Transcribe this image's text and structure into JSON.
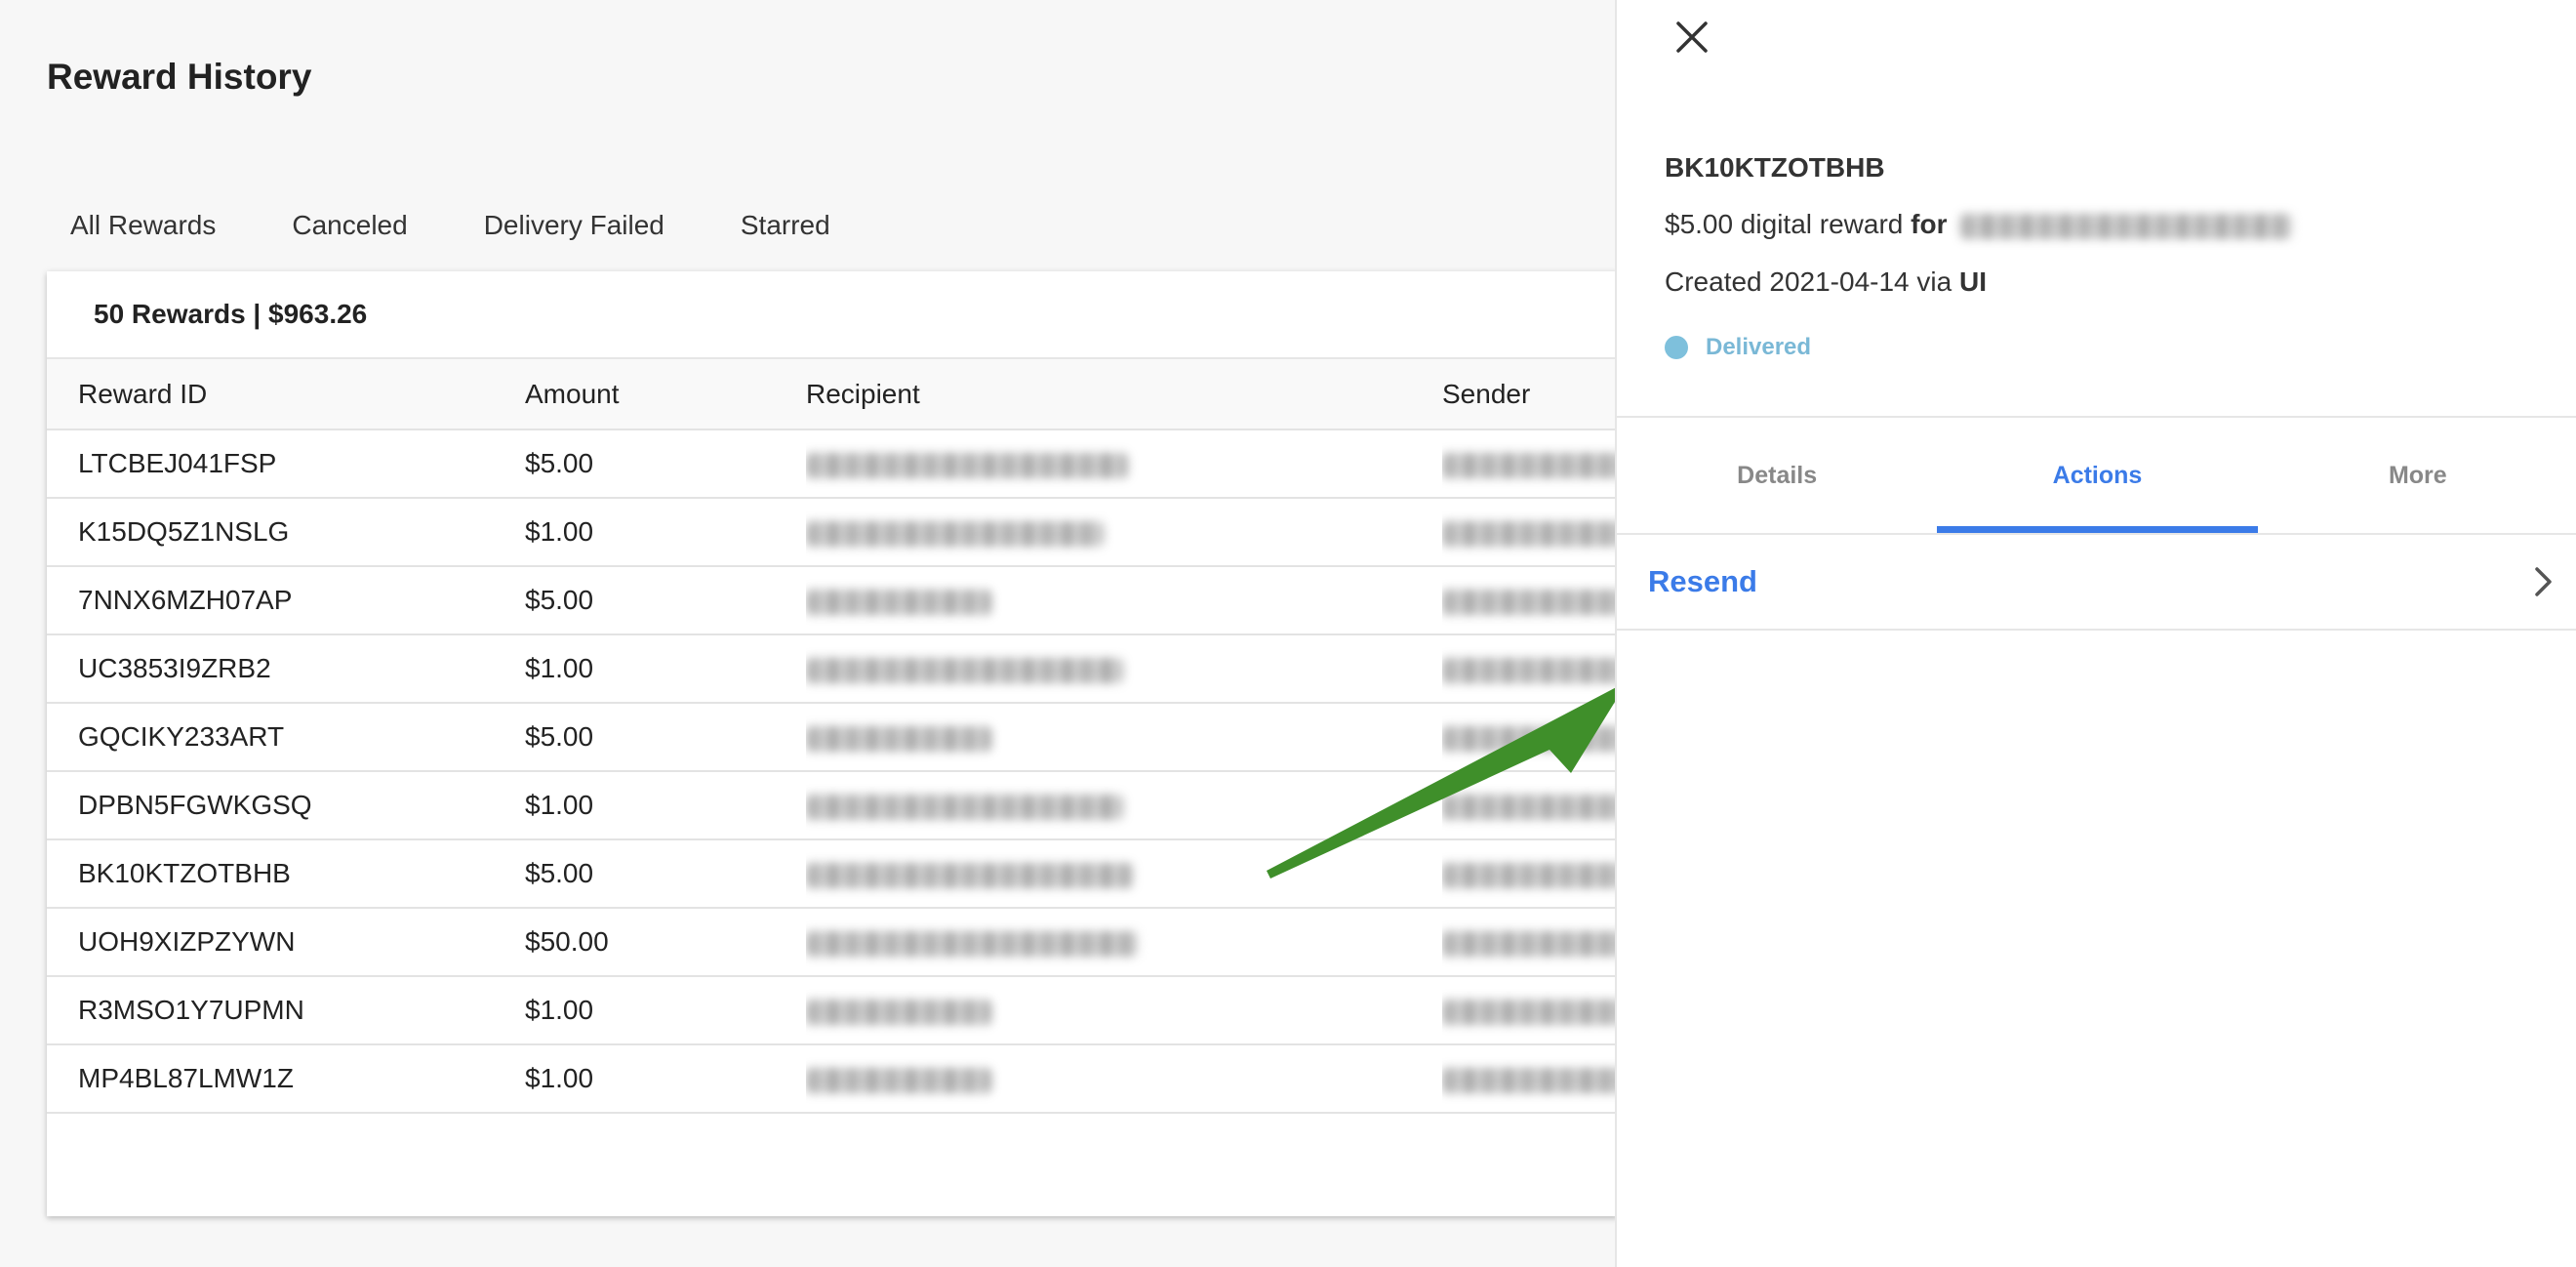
{
  "page": {
    "title": "Reward History"
  },
  "tabs": [
    "All Rewards",
    "Canceled",
    "Delivery Failed",
    "Starred"
  ],
  "summary": "50 Rewards | $963.26",
  "table": {
    "columns": [
      "Reward ID",
      "Amount",
      "Recipient",
      "Sender"
    ],
    "rows": [
      {
        "id": "LTCBEJ041FSP",
        "amount": "$5.00"
      },
      {
        "id": "K15DQ5Z1NSLG",
        "amount": "$1.00"
      },
      {
        "id": "7NNX6MZH07AP",
        "amount": "$5.00"
      },
      {
        "id": "UC3853I9ZRB2",
        "amount": "$1.00"
      },
      {
        "id": "GQCIKY233ART",
        "amount": "$5.00"
      },
      {
        "id": "DPBN5FGWKGSQ",
        "amount": "$1.00"
      },
      {
        "id": "BK10KTZOTBHB",
        "amount": "$5.00"
      },
      {
        "id": "UOH9XIZPZYWN",
        "amount": "$50.00"
      },
      {
        "id": "R3MSO1Y7UPMN",
        "amount": "$1.00"
      },
      {
        "id": "MP4BL87LMW1Z",
        "amount": "$1.00"
      }
    ]
  },
  "panel": {
    "reward_id": "BK10KTZOTBHB",
    "reward_desc": "$5.00 digital reward ",
    "for_word": "for",
    "created_prefix": "Created 2021-04-14 via ",
    "created_via": "UI",
    "status": "Delivered",
    "tabs": [
      "Details",
      "Actions",
      "More"
    ],
    "active_tab": "Actions",
    "action": "Resend"
  },
  "colors": {
    "accent": "#3b7be8",
    "status": "#7ec0dc",
    "annotation_arrow": "#3f8f2a"
  },
  "icons": {
    "close": "close-icon",
    "chevron": "chevron-right-icon",
    "annotation": "arrow-annotation-icon"
  }
}
